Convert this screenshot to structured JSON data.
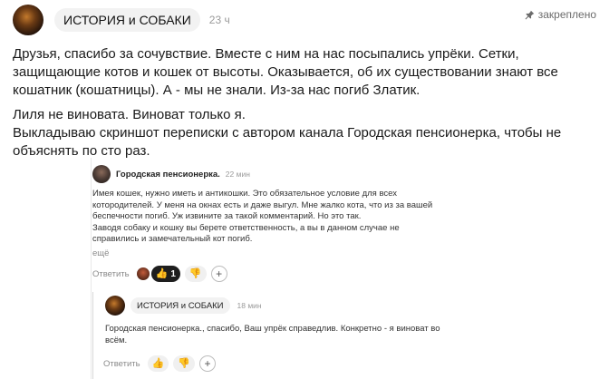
{
  "post": {
    "channel_name": "ИСТОРИЯ и СОБАКИ",
    "time_ago": "23 ч",
    "pinned_label": "закреплено",
    "paragraph_1": "Друзья, спасибо за сочувствие. Вместе с ним на нас посыпались упрёки. Сетки, защищающие котов и кошек от высоты. Оказывается, об их существовании знают все кошатник (кошатницы). А - мы не знали. Из-за нас погиб Златик.",
    "paragraph_2_line_1": "Лиля не виновата. Виноват только я.",
    "paragraph_2_line_2": "Выкладываю скриншот переписки с автором канала Городская пенсионерка, чтобы не объяснять по сто раз."
  },
  "screenshot": {
    "comment": {
      "author": "Городская пенсионерка.",
      "time": "22 мин",
      "text_line_1": "Имея кошек, нужно иметь и антикошки. Это обязательное условие для всех",
      "text_line_2": "котородителей. У меня на окнах есть и даже выгул. Мне жалко кота, что из за вашей",
      "text_line_3": "беспечности погиб. Уж извините за такой комментарий. Но это так.",
      "text_line_4": "Заводя собаку и кошку вы берете ответственность, а вы в данном случае не",
      "text_line_5": "справились и замечательный кот погиб.",
      "more_label": "ещё",
      "reply_label": "Ответить",
      "like_count": "1",
      "like_icon": "👍",
      "dislike_icon": "👎",
      "add_icon": "+"
    },
    "reply": {
      "author": "ИСТОРИЯ и СОБАКИ",
      "time": "18 мин",
      "text_line_1": "Городская пенсионерка., спасибо, Ваш упрёк справедлив. Конкретно - я виноват во",
      "text_line_2": "всём.",
      "reply_label": "Ответить",
      "like_icon": "👍",
      "dislike_icon": "👎",
      "add_icon": "+"
    }
  },
  "colors": {
    "chip_bg": "#f2f2f2",
    "active_pill": "#1e1e1e",
    "muted_text": "#9a9a9a"
  },
  "icons": [
    "avatar",
    "pin-icon",
    "thumbs-up-icon",
    "thumbs-down-icon",
    "plus-icon"
  ]
}
